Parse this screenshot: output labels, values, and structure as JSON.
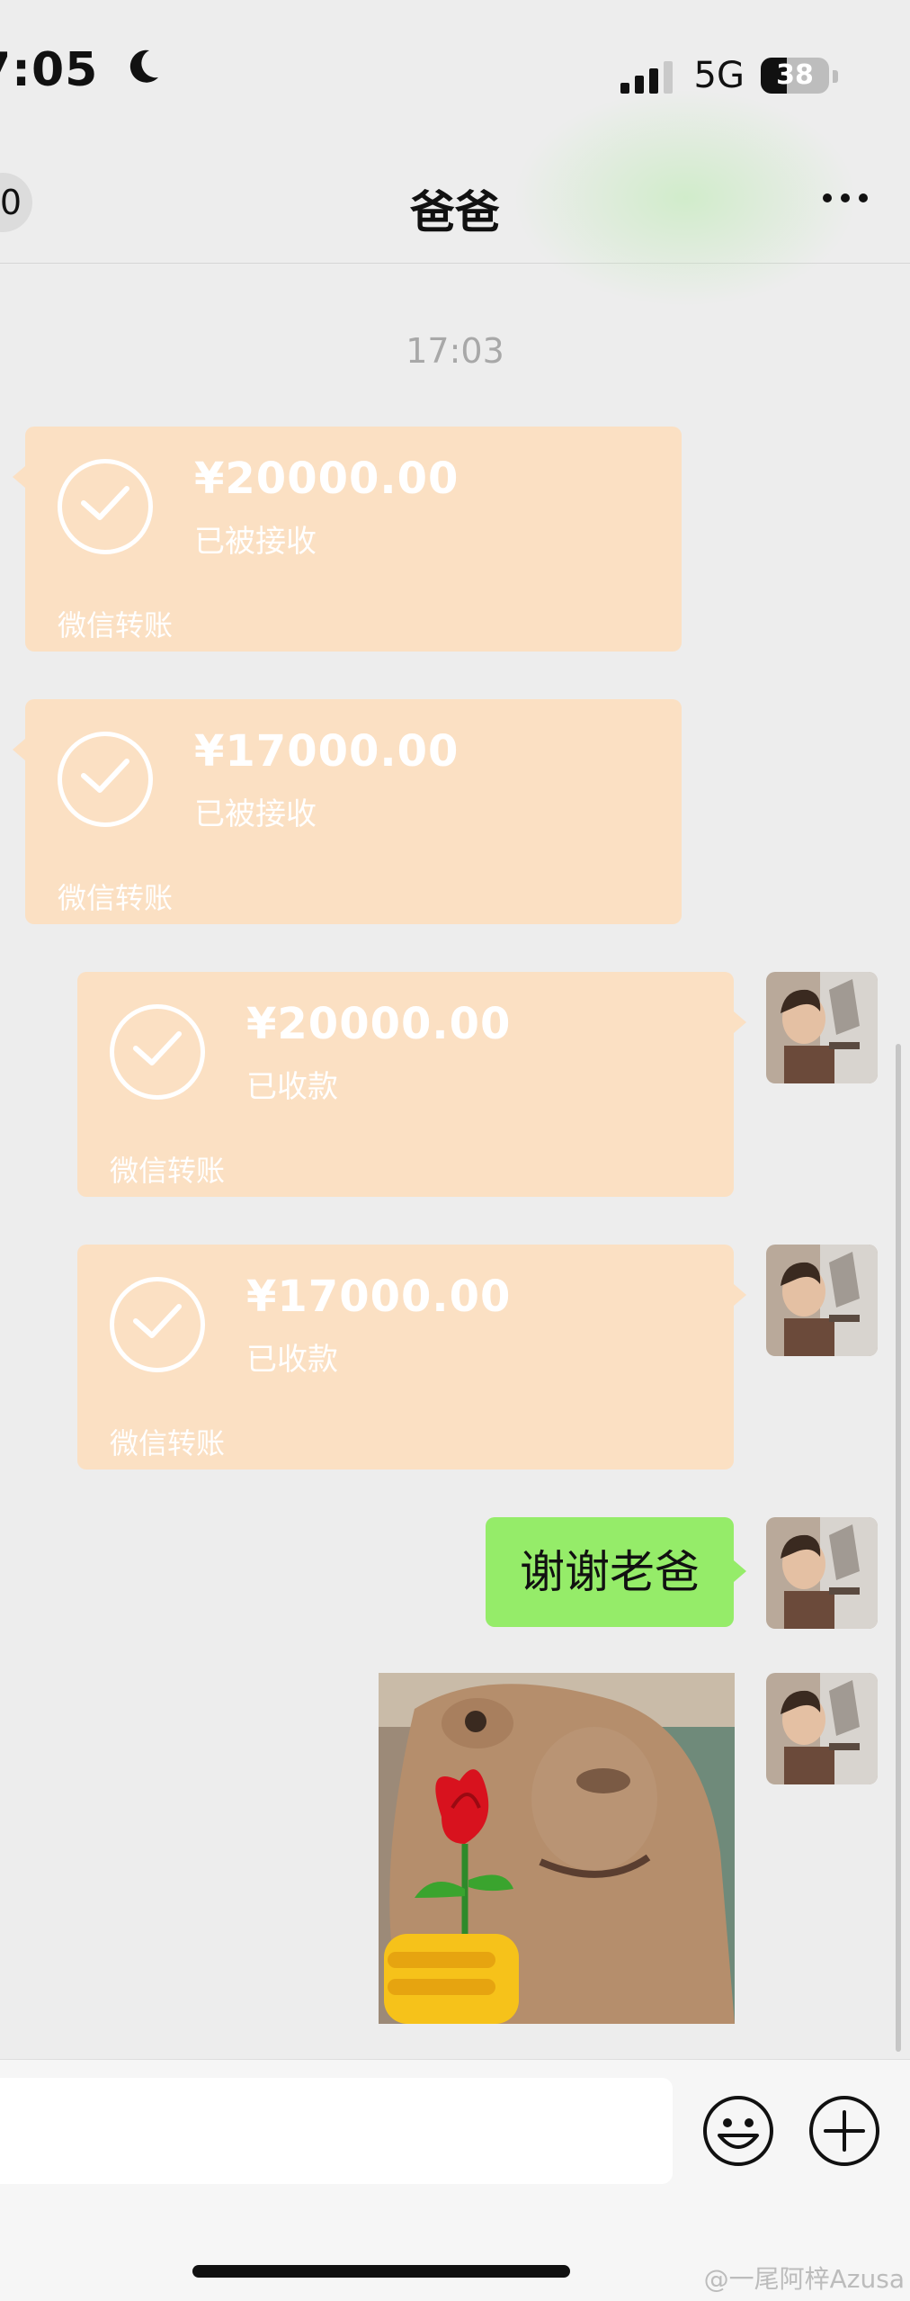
{
  "status_bar": {
    "time": "7:05",
    "network": "5G",
    "battery": "38"
  },
  "header": {
    "badge": "0",
    "title": "爸爸"
  },
  "timestamp": "17:03",
  "messages": {
    "m1": {
      "amount": "¥20000.00",
      "state": "已被接收",
      "footer": "微信转账"
    },
    "m2": {
      "amount": "¥17000.00",
      "state": "已被接收",
      "footer": "微信转账"
    },
    "m3": {
      "amount": "¥20000.00",
      "state": "已收款",
      "footer": "微信转账"
    },
    "m4": {
      "amount": "¥17000.00",
      "state": "已收款",
      "footer": "微信转账"
    },
    "m5": {
      "text": "谢谢老爸"
    }
  },
  "watermark": "@一尾阿梓Azusa",
  "colors": {
    "transfer_card": "#fbe0c3",
    "sent_bubble": "#95ec69",
    "background": "#ededed"
  }
}
